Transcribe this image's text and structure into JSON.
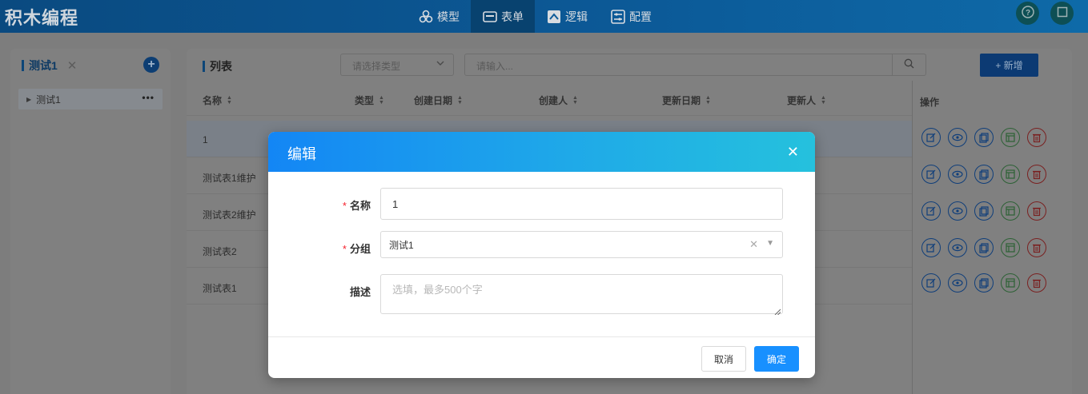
{
  "app": {
    "title": "积木编程"
  },
  "nav": [
    {
      "label": "模型",
      "icon": "cubes-icon"
    },
    {
      "label": "表单",
      "icon": "form-icon",
      "active": true
    },
    {
      "label": "逻辑",
      "icon": "logic-icon"
    },
    {
      "label": "配置",
      "icon": "config-icon"
    }
  ],
  "top_right": {
    "help_icon": "help-icon",
    "fullscreen_icon": "square-icon"
  },
  "left_panel": {
    "tab_title": "测试1",
    "close_glyph": "✕",
    "add_glyph": "+",
    "tree": [
      {
        "label": "测试1",
        "more": "•••"
      }
    ]
  },
  "list": {
    "title": "列表",
    "type_select_placeholder": "请选择类型",
    "search_placeholder": "请输入...",
    "add_button": "+ 新增",
    "columns": [
      "名称",
      "类型",
      "创建日期",
      "创建人",
      "更新日期",
      "更新人"
    ],
    "action_column": "操作",
    "rows": [
      {
        "name": "1",
        "selected": true
      },
      {
        "name": "测试表1维护"
      },
      {
        "name": "测试表2维护"
      },
      {
        "name": "测试表2"
      },
      {
        "name": "测试表1"
      }
    ],
    "row_actions": [
      "edit-icon",
      "view-icon",
      "copy-icon",
      "layout-icon",
      "delete-icon"
    ]
  },
  "modal": {
    "title": "编辑",
    "close_glyph": "✕",
    "fields": {
      "name": {
        "label": "名称",
        "required_mark": "*",
        "value": "1"
      },
      "group": {
        "label": "分组",
        "required_mark": "*",
        "value": "测试1",
        "clear_glyph": "✕"
      },
      "desc": {
        "label": "描述",
        "placeholder": "选填，最多500个字"
      }
    },
    "cancel": "取消",
    "ok": "确定"
  },
  "colors": {
    "primary": "#1890ff",
    "header_start": "#1386f5",
    "header_end": "#25c1dd",
    "required": "#f5222d"
  }
}
